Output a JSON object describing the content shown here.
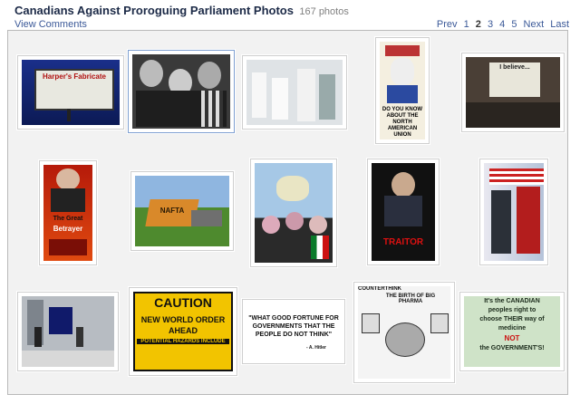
{
  "album": {
    "title": "Canadians Against Proroguing Parliament Photos",
    "count": "167 photos",
    "view_comments": "View Comments"
  },
  "pager": {
    "prev": "Prev",
    "pages": [
      "1",
      "2",
      "3",
      "4",
      "5"
    ],
    "current": "2",
    "next": "Next",
    "last": "Last"
  },
  "photos": {
    "p1": {
      "text": "Harper's Fabricate"
    },
    "p4": {
      "text": "DO YOU KNOW ABOUT THE NORTH AMERICAN UNION"
    },
    "p5": {
      "text": "I believe..."
    },
    "p6": {
      "text1": "The Great",
      "text2": "Betrayer"
    },
    "p7": {
      "text": "NAFTA"
    },
    "p9": {
      "text": "TRAITOR"
    },
    "p12": {
      "line1": "CAUTION",
      "line2": "NEW WORLD ORDER",
      "line3": "AHEAD",
      "line4": "POTENTIAL HAZARDS INCLUDE"
    },
    "p13": {
      "text": "\"WHAT GOOD FORTUNE FOR GOVERNMENTS THAT THE PEOPLE DO NOT THINK\"",
      "attribution": "- A. Hitler"
    },
    "p14": {
      "header": "COUNTERTHINK",
      "title": "THE BIRTH OF BIG PHARMA"
    },
    "p15": {
      "line1": "It's the CANADIAN",
      "line2": "peoples right to",
      "line3": "choose THEIR way of",
      "line4": "medicine",
      "line5": "NOT",
      "line6": "the GOVERNMENT'S!"
    }
  }
}
